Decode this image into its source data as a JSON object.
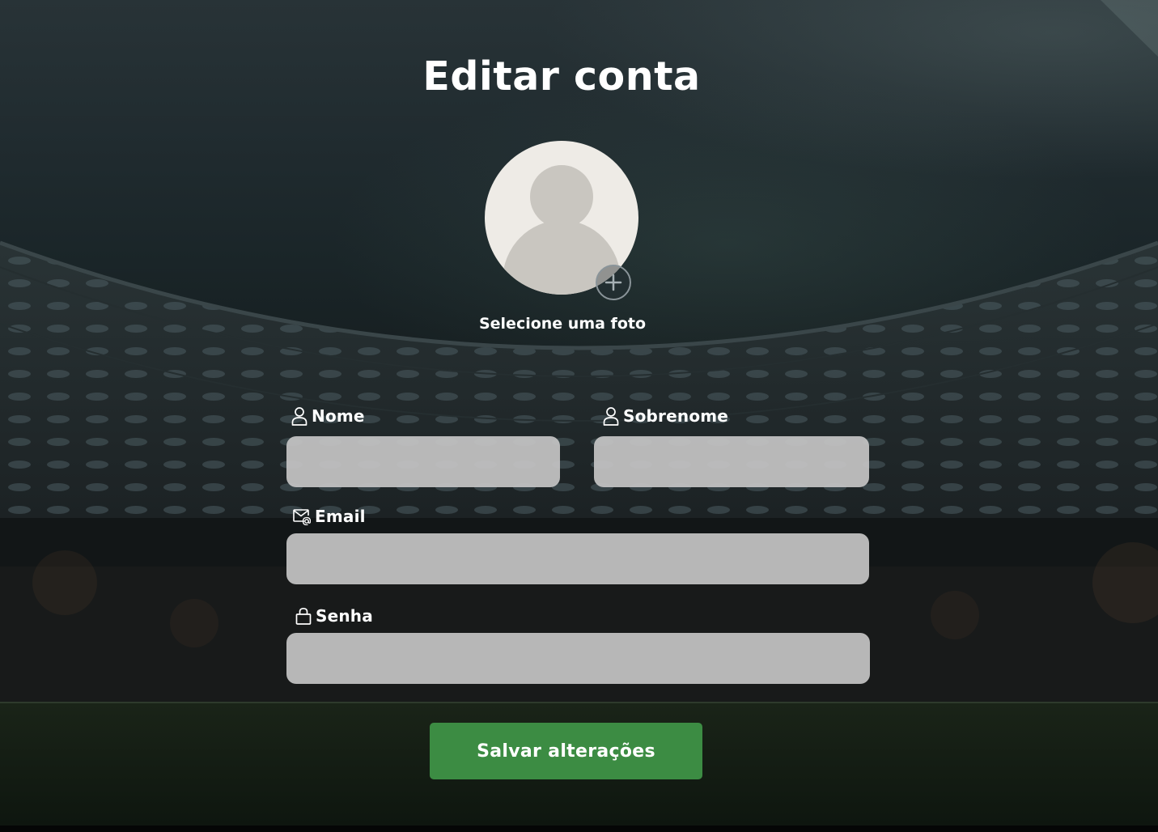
{
  "page": {
    "title": "Editar conta"
  },
  "avatar": {
    "select_label": "Selecione uma foto",
    "add_icon": "plus-circle-icon",
    "placeholder_icon": "user-silhouette-icon"
  },
  "form": {
    "first_name": {
      "label": "Nome",
      "icon": "user-icon",
      "value": ""
    },
    "last_name": {
      "label": "Sobrenome",
      "icon": "user-icon",
      "value": ""
    },
    "email": {
      "label": "Email",
      "icon": "mail-at-icon",
      "value": ""
    },
    "password": {
      "label": "Senha",
      "icon": "lock-icon",
      "value": ""
    },
    "submit_label": "Salvar alterações"
  },
  "colors": {
    "submit_button": "#3c8c43",
    "input_background": "#c4c4c4",
    "avatar_background": "#eeebe6",
    "text": "#ffffff"
  }
}
